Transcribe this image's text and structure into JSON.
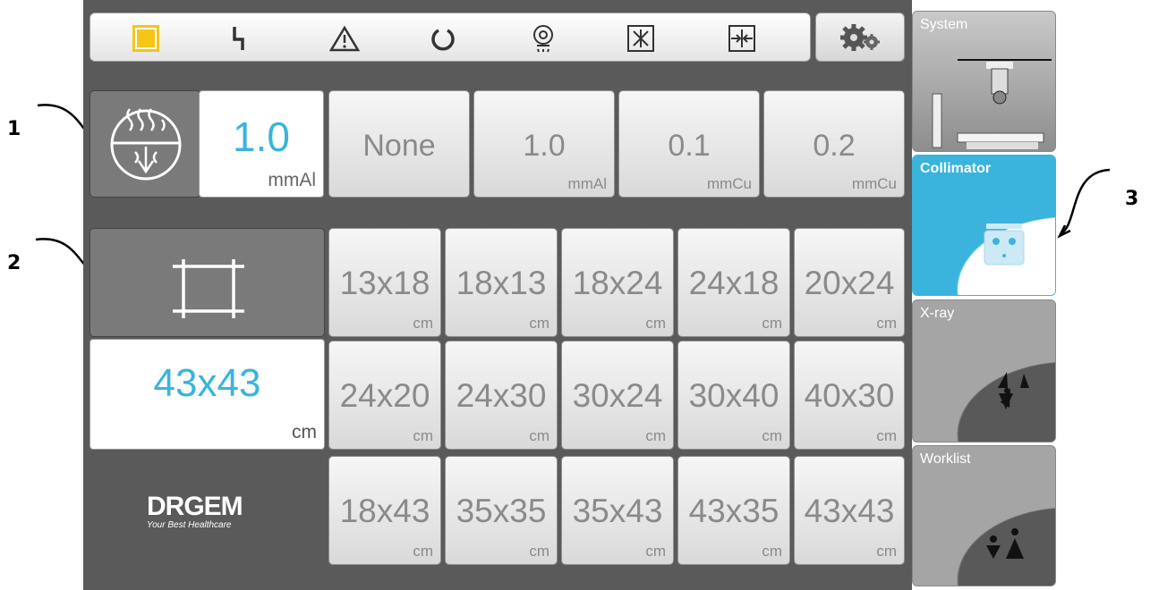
{
  "callouts": [
    "1",
    "2",
    "3"
  ],
  "toolbar": {
    "icons": [
      "stop-square-icon",
      "lightning-icon",
      "warning-icon",
      "rotation-icon",
      "lamp-icon",
      "collapse-t-icon",
      "collapse-l-icon"
    ],
    "settings_icon": "gears-icon"
  },
  "filter": {
    "current_value": "1.0",
    "current_unit": "mmAl",
    "options": [
      {
        "value": "None",
        "unit": ""
      },
      {
        "value": "1.0",
        "unit": "mmAl"
      },
      {
        "value": "0.1",
        "unit": "mmCu"
      },
      {
        "value": "0.2",
        "unit": "mmCu"
      }
    ]
  },
  "field_size": {
    "current_value": "43x43",
    "current_unit": "cm",
    "rows": [
      [
        {
          "value": "13x18",
          "unit": "cm"
        },
        {
          "value": "18x13",
          "unit": "cm"
        },
        {
          "value": "18x24",
          "unit": "cm"
        },
        {
          "value": "24x18",
          "unit": "cm"
        },
        {
          "value": "20x24",
          "unit": "cm"
        }
      ],
      [
        {
          "value": "24x20",
          "unit": "cm"
        },
        {
          "value": "24x30",
          "unit": "cm"
        },
        {
          "value": "30x24",
          "unit": "cm"
        },
        {
          "value": "30x40",
          "unit": "cm"
        },
        {
          "value": "40x30",
          "unit": "cm"
        }
      ],
      [
        {
          "value": "18x43",
          "unit": "cm"
        },
        {
          "value": "35x35",
          "unit": "cm"
        },
        {
          "value": "35x43",
          "unit": "cm"
        },
        {
          "value": "43x35",
          "unit": "cm"
        },
        {
          "value": "43x43",
          "unit": "cm"
        }
      ]
    ]
  },
  "logo": {
    "name": "DRGEM",
    "tagline": "Your Best Healthcare"
  },
  "side_tabs": [
    {
      "label": "System",
      "active": false
    },
    {
      "label": "Collimator",
      "active": true
    },
    {
      "label": "X-ray",
      "active": false
    },
    {
      "label": "Worklist",
      "active": false
    }
  ],
  "colors": {
    "accent": "#3ab4dc",
    "panel": "#5a5a5a",
    "yellow": "#f5c518"
  }
}
